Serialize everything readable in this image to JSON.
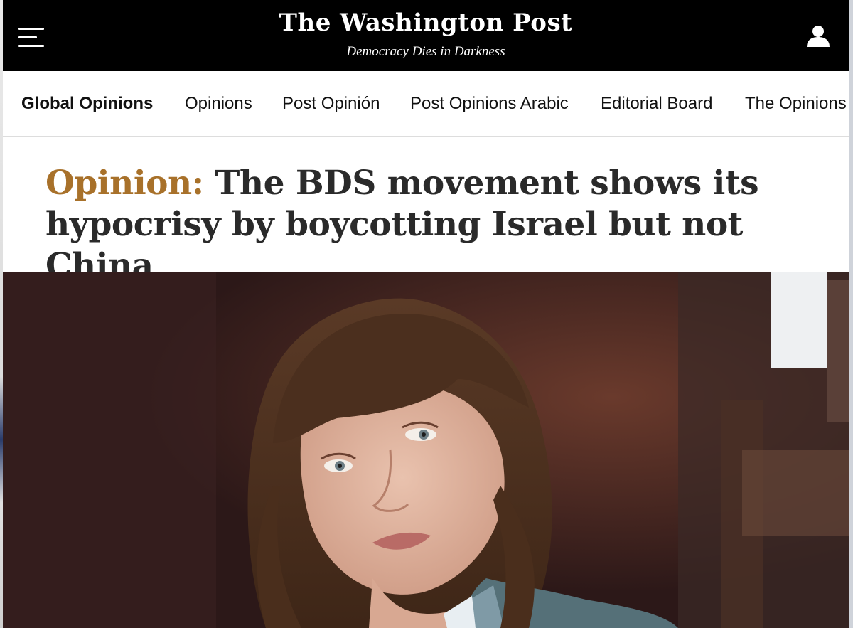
{
  "masthead": {
    "brand": "The Washington Post",
    "tagline": "Democracy Dies in Darkness",
    "menu_icon": "hamburger-menu-icon",
    "account_icon": "user-account-icon"
  },
  "nav": {
    "items": [
      {
        "label": "Global Opinions",
        "active": true
      },
      {
        "label": "Opinions"
      },
      {
        "label": "Post Opinión"
      },
      {
        "label": "Post Opinions Arabic"
      },
      {
        "label": "Editorial Board"
      },
      {
        "label": "The Opinions"
      }
    ]
  },
  "article": {
    "kicker": "Opinion:",
    "headline": " The BDS movement shows its hypocrisy by boycotting Israel but not China"
  },
  "colors": {
    "masthead_bg": "#000000",
    "kicker": "#a8712a",
    "headline": "#2a2a2a"
  }
}
